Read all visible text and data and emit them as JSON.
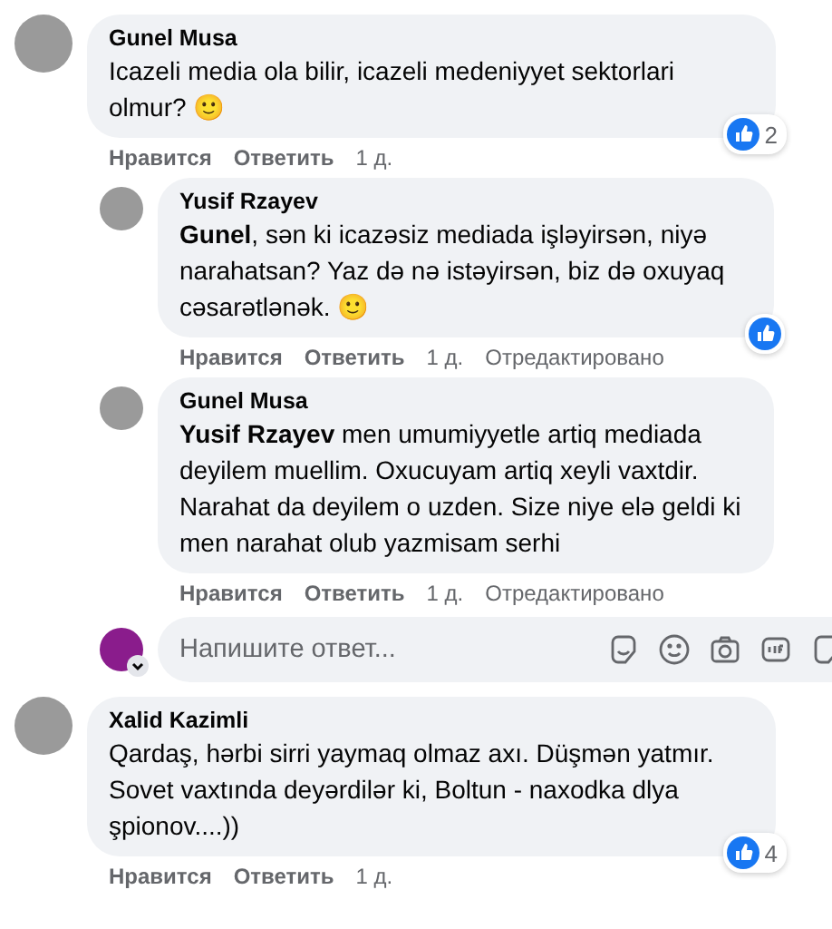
{
  "comments": [
    {
      "author": "Gunel Musa",
      "text": "Icazeli media ola bilir, icazeli medeniyyet sektorlari olmur? 🙂",
      "reaction": {
        "kind": "like",
        "count": "2"
      },
      "like_label": "Нравится",
      "reply_label": "Ответить",
      "time": "1 д.",
      "replies": [
        {
          "author": "Yusif Rzayev",
          "text": "**Gunel**, sən ki icazəsiz mediada işləyirsən, niyə narahatsan? Yaz də nə istəyirsən, biz də oxuyaq cəsarətlənək. 🙂",
          "reaction": {
            "kind": "like"
          },
          "like_label": "Нравится",
          "reply_label": "Ответить",
          "time": "1 д.",
          "edited_label": "Отредактировано"
        },
        {
          "author": "Gunel Musa",
          "text": "**Yusif Rzayev** men umumiyyetle artiq mediada deyilem muellim. Oxucuyam artiq xeyli vaxtdir. Narahat da deyilem o uzden. Size niye elə geldi ki men narahat olub yazmisam serhi",
          "like_label": "Нравится",
          "reply_label": "Ответить",
          "time": "1 д.",
          "edited_label": "Отредактировано"
        }
      ],
      "reply_box": {
        "placeholder": "Напишите ответ..."
      }
    },
    {
      "author": "Xalid Kazimli",
      "text": "Qardaş, hərbi sirri yaymaq olmaz axı. Düşmən yatmır. Sovet vaxtında deyərdilər ki, Boltun - naxodka dlya şpionov....))",
      "reaction": {
        "kind": "like",
        "count": "4"
      },
      "like_label": "Нравится",
      "reply_label": "Ответить",
      "time": "1 д."
    }
  ]
}
